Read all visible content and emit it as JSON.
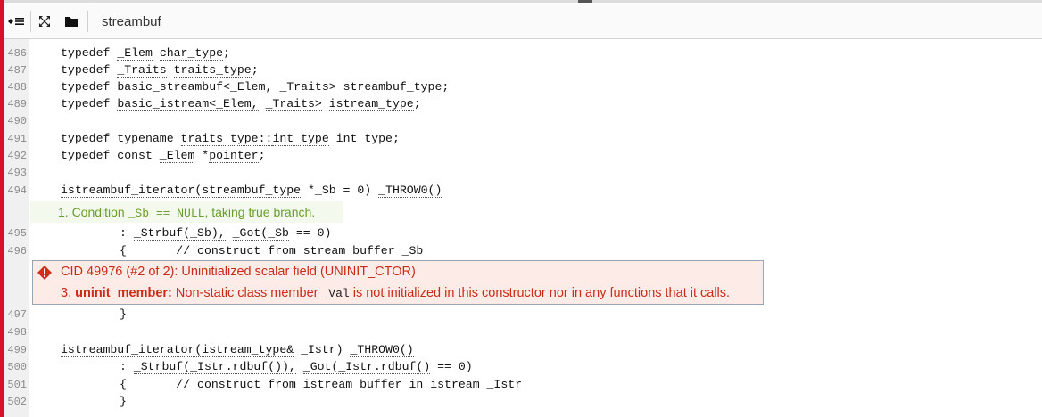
{
  "toolbar": {
    "outline_icon": "outline-toggle-icon",
    "expand_icon": "expand-icon",
    "folder_icon": "folder-icon",
    "file_name": "streambuf"
  },
  "code_lines": [
    {
      "num": "486",
      "text": "typedef _Elem char_type;"
    },
    {
      "num": "487",
      "text": "typedef _Traits traits_type;"
    },
    {
      "num": "488",
      "text": "typedef basic_streambuf<_Elem, _Traits> streambuf_type;"
    },
    {
      "num": "489",
      "text": "typedef basic_istream<_Elem, _Traits> istream_type;"
    },
    {
      "num": "490",
      "text": ""
    },
    {
      "num": "491",
      "text": "typedef typename traits_type::int_type int_type;"
    },
    {
      "num": "492",
      "text": "typedef const _Elem *pointer;"
    },
    {
      "num": "493",
      "text": ""
    },
    {
      "num": "494",
      "text": "istreambuf_iterator(streambuf_type *_Sb = 0) _THROW0()"
    },
    {
      "num": "495",
      "text": ": _Strbuf(_Sb), _Got(_Sb == 0)"
    },
    {
      "num": "496",
      "text": "{       // construct from stream buffer _Sb"
    },
    {
      "num": "497",
      "text": "}"
    },
    {
      "num": "498",
      "text": ""
    },
    {
      "num": "499",
      "text": "istreambuf_iterator(istream_type& _Istr) _THROW0()"
    },
    {
      "num": "500",
      "text": ": _Strbuf(_Istr.rdbuf()), _Got(_Istr.rdbuf() == 0)"
    },
    {
      "num": "501",
      "text": "{       // construct from istream buffer in istream _Istr"
    },
    {
      "num": "502",
      "text": "}"
    }
  ],
  "event": {
    "prefix": "1. Condition ",
    "code": "_Sb == NULL",
    "suffix": ", taking true branch."
  },
  "defect": {
    "title": "CID 49976 (#2 of 2): Uninitialized scalar field (UNINIT_CTOR)",
    "step_num": "3.",
    "step_label": "uninit_member:",
    "step_text1": " Non-static class member ",
    "member": "_Val",
    "step_text2": " is not initialized in this constructor nor in any functions that it calls.",
    "color": "#cc2b17"
  }
}
